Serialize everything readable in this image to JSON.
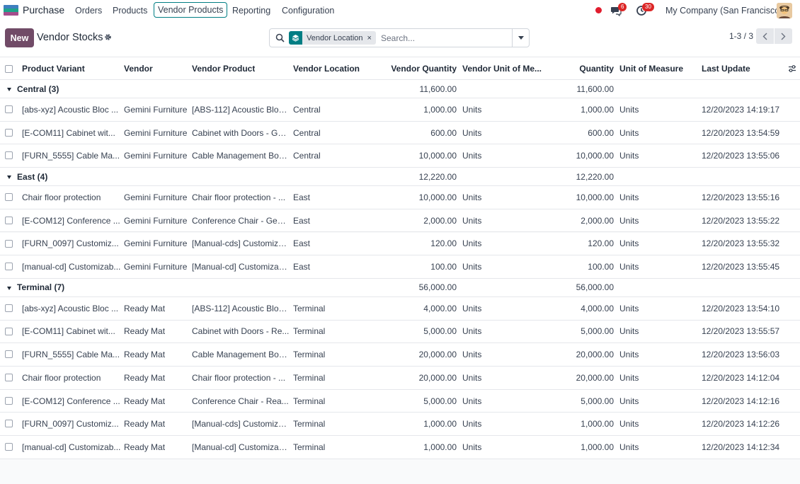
{
  "navbar": {
    "brand": "Purchase",
    "menu": [
      "Orders",
      "Products",
      "Vendor Products",
      "Reporting",
      "Configuration"
    ],
    "active_menu": "Vendor Products",
    "messages_count": "6",
    "activities_count": "30",
    "company": "My Company (San Francisco)"
  },
  "control": {
    "new_label": "New",
    "title": "Vendor Stocks",
    "facet_label": "Vendor Location",
    "search_placeholder": "Search...",
    "pager": "1-3 / 3"
  },
  "table": {
    "headers": [
      "Product Variant",
      "Vendor",
      "Vendor Product",
      "Vendor Location",
      "Vendor Quantity",
      "Vendor Unit of Me...",
      "Quantity",
      "Unit of Measure",
      "Last Update"
    ],
    "groups": [
      {
        "label": "Central (3)",
        "vendor_qty": "11,600.00",
        "qty": "11,600.00",
        "rows": [
          [
            "[abs-xyz] Acoustic Bloc ...",
            "Gemini Furniture",
            "[ABS-112] Acoustic Bloc...",
            "Central",
            "1,000.00",
            "Units",
            "1,000.00",
            "Units",
            "12/20/2023 14:19:17"
          ],
          [
            "[E-COM11] Cabinet wit...",
            "Gemini Furniture",
            "Cabinet with Doors - Ge...",
            "Central",
            "600.00",
            "Units",
            "600.00",
            "Units",
            "12/20/2023 13:54:59"
          ],
          [
            "[FURN_5555] Cable Ma...",
            "Gemini Furniture",
            "Cable Management Box...",
            "Central",
            "10,000.00",
            "Units",
            "10,000.00",
            "Units",
            "12/20/2023 13:55:06"
          ]
        ]
      },
      {
        "label": "East (4)",
        "vendor_qty": "12,220.00",
        "qty": "12,220.00",
        "rows": [
          [
            "Chair floor protection",
            "Gemini Furniture",
            "Chair floor protection - ...",
            "East",
            "10,000.00",
            "Units",
            "10,000.00",
            "Units",
            "12/20/2023 13:55:16"
          ],
          [
            "[E-COM12] Conference ...",
            "Gemini Furniture",
            "Conference Chair - Gem...",
            "East",
            "2,000.00",
            "Units",
            "2,000.00",
            "Units",
            "12/20/2023 13:55:22"
          ],
          [
            "[FURN_0097] Customiz...",
            "Gemini Furniture",
            "[Manual-cds] Customiza...",
            "East",
            "120.00",
            "Units",
            "120.00",
            "Units",
            "12/20/2023 13:55:32"
          ],
          [
            "[manual-cd] Customizab...",
            "Gemini Furniture",
            "[Manual-cd] Customizab...",
            "East",
            "100.00",
            "Units",
            "100.00",
            "Units",
            "12/20/2023 13:55:45"
          ]
        ]
      },
      {
        "label": "Terminal (7)",
        "vendor_qty": "56,000.00",
        "qty": "56,000.00",
        "rows": [
          [
            "[abs-xyz] Acoustic Bloc ...",
            "Ready Mat",
            "[ABS-112] Acoustic Bloc...",
            "Terminal",
            "4,000.00",
            "Units",
            "4,000.00",
            "Units",
            "12/20/2023 13:54:10"
          ],
          [
            "[E-COM11] Cabinet wit...",
            "Ready Mat",
            "Cabinet with Doors - Re...",
            "Terminal",
            "5,000.00",
            "Units",
            "5,000.00",
            "Units",
            "12/20/2023 13:55:57"
          ],
          [
            "[FURN_5555] Cable Ma...",
            "Ready Mat",
            "Cable Management Box...",
            "Terminal",
            "20,000.00",
            "Units",
            "20,000.00",
            "Units",
            "12/20/2023 13:56:03"
          ],
          [
            "Chair floor protection",
            "Ready Mat",
            "Chair floor protection - ...",
            "Terminal",
            "20,000.00",
            "Units",
            "20,000.00",
            "Units",
            "12/20/2023 14:12:04"
          ],
          [
            "[E-COM12] Conference ...",
            "Ready Mat",
            "Conference Chair - Rea...",
            "Terminal",
            "5,000.00",
            "Units",
            "5,000.00",
            "Units",
            "12/20/2023 14:12:16"
          ],
          [
            "[FURN_0097] Customiz...",
            "Ready Mat",
            "[Manual-cds] Customiza...",
            "Terminal",
            "1,000.00",
            "Units",
            "1,000.00",
            "Units",
            "12/20/2023 14:12:26"
          ],
          [
            "[manual-cd] Customizab...",
            "Ready Mat",
            "[Manual-cd] Customizab...",
            "Terminal",
            "1,000.00",
            "Units",
            "1,000.00",
            "Units",
            "12/20/2023 14:12:34"
          ]
        ]
      }
    ]
  },
  "colors": {
    "brand_primary": "#714b67",
    "accent_teal": "#017e84",
    "badge_red": "#dc2626"
  }
}
